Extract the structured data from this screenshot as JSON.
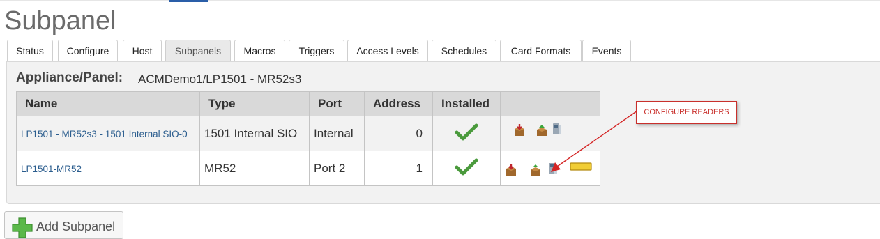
{
  "page": {
    "title": "Subpanel"
  },
  "tabs": [
    "Status",
    "Configure",
    "Host",
    "Subpanels",
    "Macros",
    "Triggers",
    "Access Levels",
    "Schedules",
    "Card Formats",
    "Events"
  ],
  "active_tab": "Subpanels",
  "appliance": {
    "label": "Appliance/Panel:",
    "value": "ACMDemo1/LP1501 - MR52s3"
  },
  "table": {
    "headers": [
      "Name",
      "Type",
      "Port",
      "Address",
      "Installed",
      ""
    ],
    "rows": [
      {
        "name": "LP1501 - MR52s3 - 1501 Internal SIO-0",
        "type": "1501 Internal SIO",
        "port": "Internal",
        "address": "0"
      },
      {
        "name": "LP1501-MR52",
        "type": "MR52",
        "port": "Port 2",
        "address": "1"
      }
    ]
  },
  "callout": {
    "text": "CONFIGURE READERS"
  },
  "add_button": {
    "label": "Add Subpanel"
  },
  "colors": {
    "accent": "#2a5ea8",
    "link": "#2b5d8e",
    "callout": "#c9302c",
    "check": "#4a9a3c"
  }
}
